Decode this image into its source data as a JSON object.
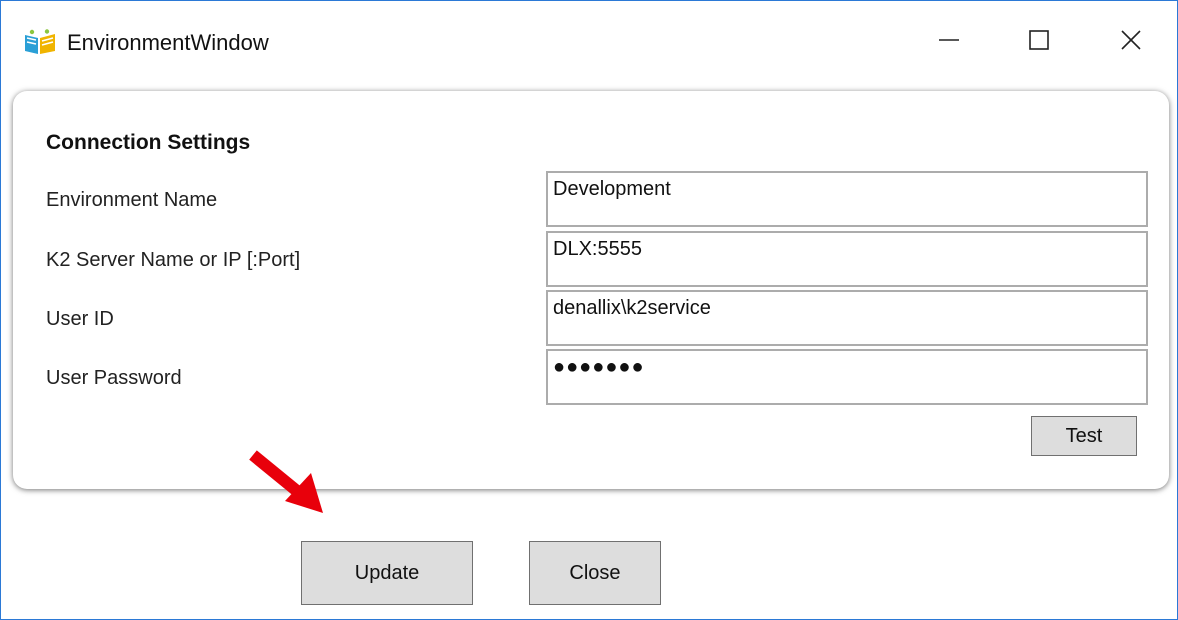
{
  "window": {
    "title": "EnvironmentWindow",
    "controls": {
      "minimize": "—",
      "maximize": "☐",
      "close": "✕"
    }
  },
  "connection": {
    "heading": "Connection Settings",
    "fields": [
      {
        "label": "Environment Name",
        "value": "Development"
      },
      {
        "label": "K2 Server Name or IP [:Port]",
        "value": "DLX:5555"
      },
      {
        "label": "User ID",
        "value": "denallix\\k2service"
      },
      {
        "label": "User Password",
        "value": "●●●●●●●"
      }
    ],
    "test_label": "Test"
  },
  "footer": {
    "update_label": "Update",
    "close_label": "Close"
  },
  "colors": {
    "window_border": "#2b79d6",
    "button_bg": "#dddddd",
    "field_border": "#acacac",
    "annotation_arrow": "#e8000b"
  },
  "icons": {
    "app": "book-icon",
    "annotation": "red-arrow-icon"
  }
}
